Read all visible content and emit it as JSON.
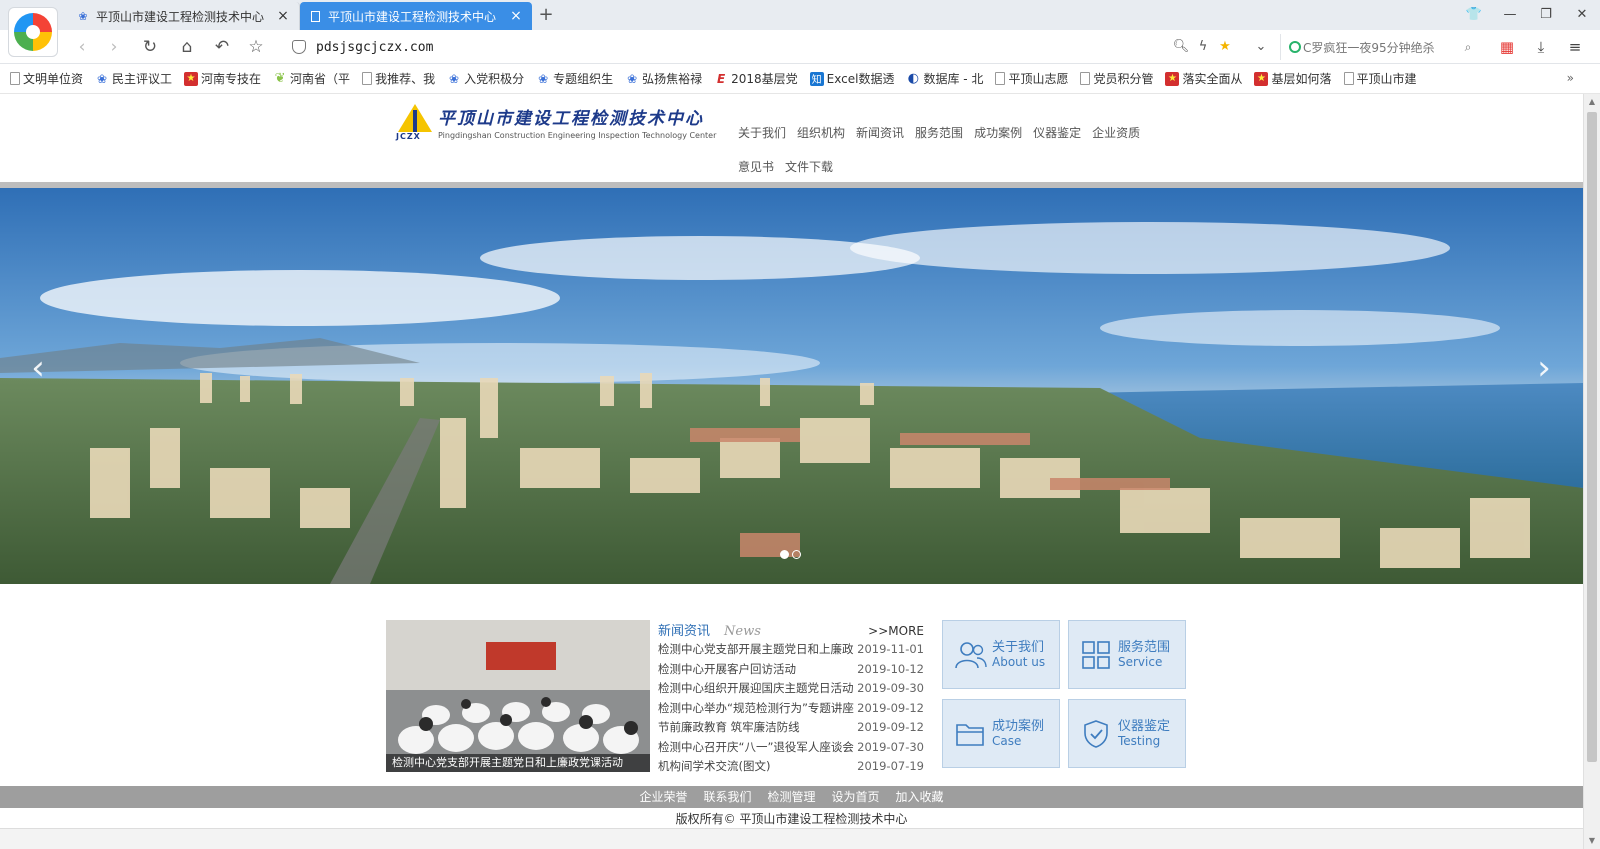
{
  "browser": {
    "tabs": [
      {
        "title": "平顶山市建设工程检测技术中心",
        "active": false
      },
      {
        "title": "平顶山市建设工程检测技术中心",
        "active": true
      }
    ],
    "url": "pdsjsgcjczx.com",
    "search_query": "C罗疯狂一夜95分钟绝杀",
    "bookmarks": [
      {
        "label": "文明单位资",
        "icon": "doc"
      },
      {
        "label": "民主评议工",
        "icon": "paw"
      },
      {
        "label": "河南专技在",
        "icon": "red"
      },
      {
        "label": "河南省（平",
        "icon": "leaf"
      },
      {
        "label": "我推荐、我",
        "icon": "doc"
      },
      {
        "label": "入党积极分",
        "icon": "paw"
      },
      {
        "label": "专题组织生",
        "icon": "paw"
      },
      {
        "label": "弘扬焦裕禄",
        "icon": "paw"
      },
      {
        "label": "2018基层党",
        "icon": "e"
      },
      {
        "label": "Excel数据透",
        "icon": "zhi"
      },
      {
        "label": "数据库 - 北",
        "icon": "db"
      },
      {
        "label": "平顶山志愿",
        "icon": "doc"
      },
      {
        "label": "党员积分管",
        "icon": "doc"
      },
      {
        "label": "落实全面从",
        "icon": "red"
      },
      {
        "label": "基层如何落",
        "icon": "red"
      },
      {
        "label": "平顶山市建",
        "icon": "doc"
      }
    ],
    "bookmarks_more": "»"
  },
  "site": {
    "logo_cn": "平顶山市建设工程检测技术中心",
    "logo_en": "Pingdingshan Construction Engineering Inspection Technology Center",
    "logo_letters": "JCZX",
    "nav": [
      "关于我们",
      "组织机构",
      "新闻资讯",
      "服务范围",
      "成功案例",
      "仪器鉴定",
      "企业资质",
      "意见书",
      "文件下载"
    ],
    "banner": {
      "prev": "‹",
      "next": "›",
      "slide_count": 2,
      "active_slide": 1
    },
    "news": {
      "title_cn": "新闻资讯",
      "title_en": "News",
      "more": ">>MORE",
      "photo_caption": "检测中心党支部开展主题党日和上廉政党课活动",
      "items": [
        {
          "title": "检测中心党支部开展主题党日和上廉政",
          "date": "2019-11-01"
        },
        {
          "title": "检测中心开展客户回访活动",
          "date": "2019-10-12"
        },
        {
          "title": "检测中心组织开展迎国庆主题党日活动",
          "date": "2019-09-30"
        },
        {
          "title": "检测中心举办“规范检测行为”专题讲座",
          "date": "2019-09-12"
        },
        {
          "title": "节前廉政教育 筑牢廉洁防线",
          "date": "2019-09-12"
        },
        {
          "title": "检测中心召开庆“八一”退役军人座谈会",
          "date": "2019-07-30"
        },
        {
          "title": "机构间学术交流(图文)",
          "date": "2019-07-19"
        }
      ]
    },
    "quick_links": [
      {
        "cn": "关于我们",
        "en": "About us",
        "icon": "users-icon"
      },
      {
        "cn": "服务范围",
        "en": "Service",
        "icon": "grid-icon"
      },
      {
        "cn": "成功案例",
        "en": "Case",
        "icon": "folder-icon"
      },
      {
        "cn": "仪器鉴定",
        "en": "Testing",
        "icon": "shield-check-icon"
      }
    ],
    "footer_links": [
      "企业荣誉",
      "联系我们",
      "检测管理",
      "设为首页",
      "加入收藏"
    ],
    "copyright": "版权所有© 平顶山市建设工程检测技术中心"
  }
}
